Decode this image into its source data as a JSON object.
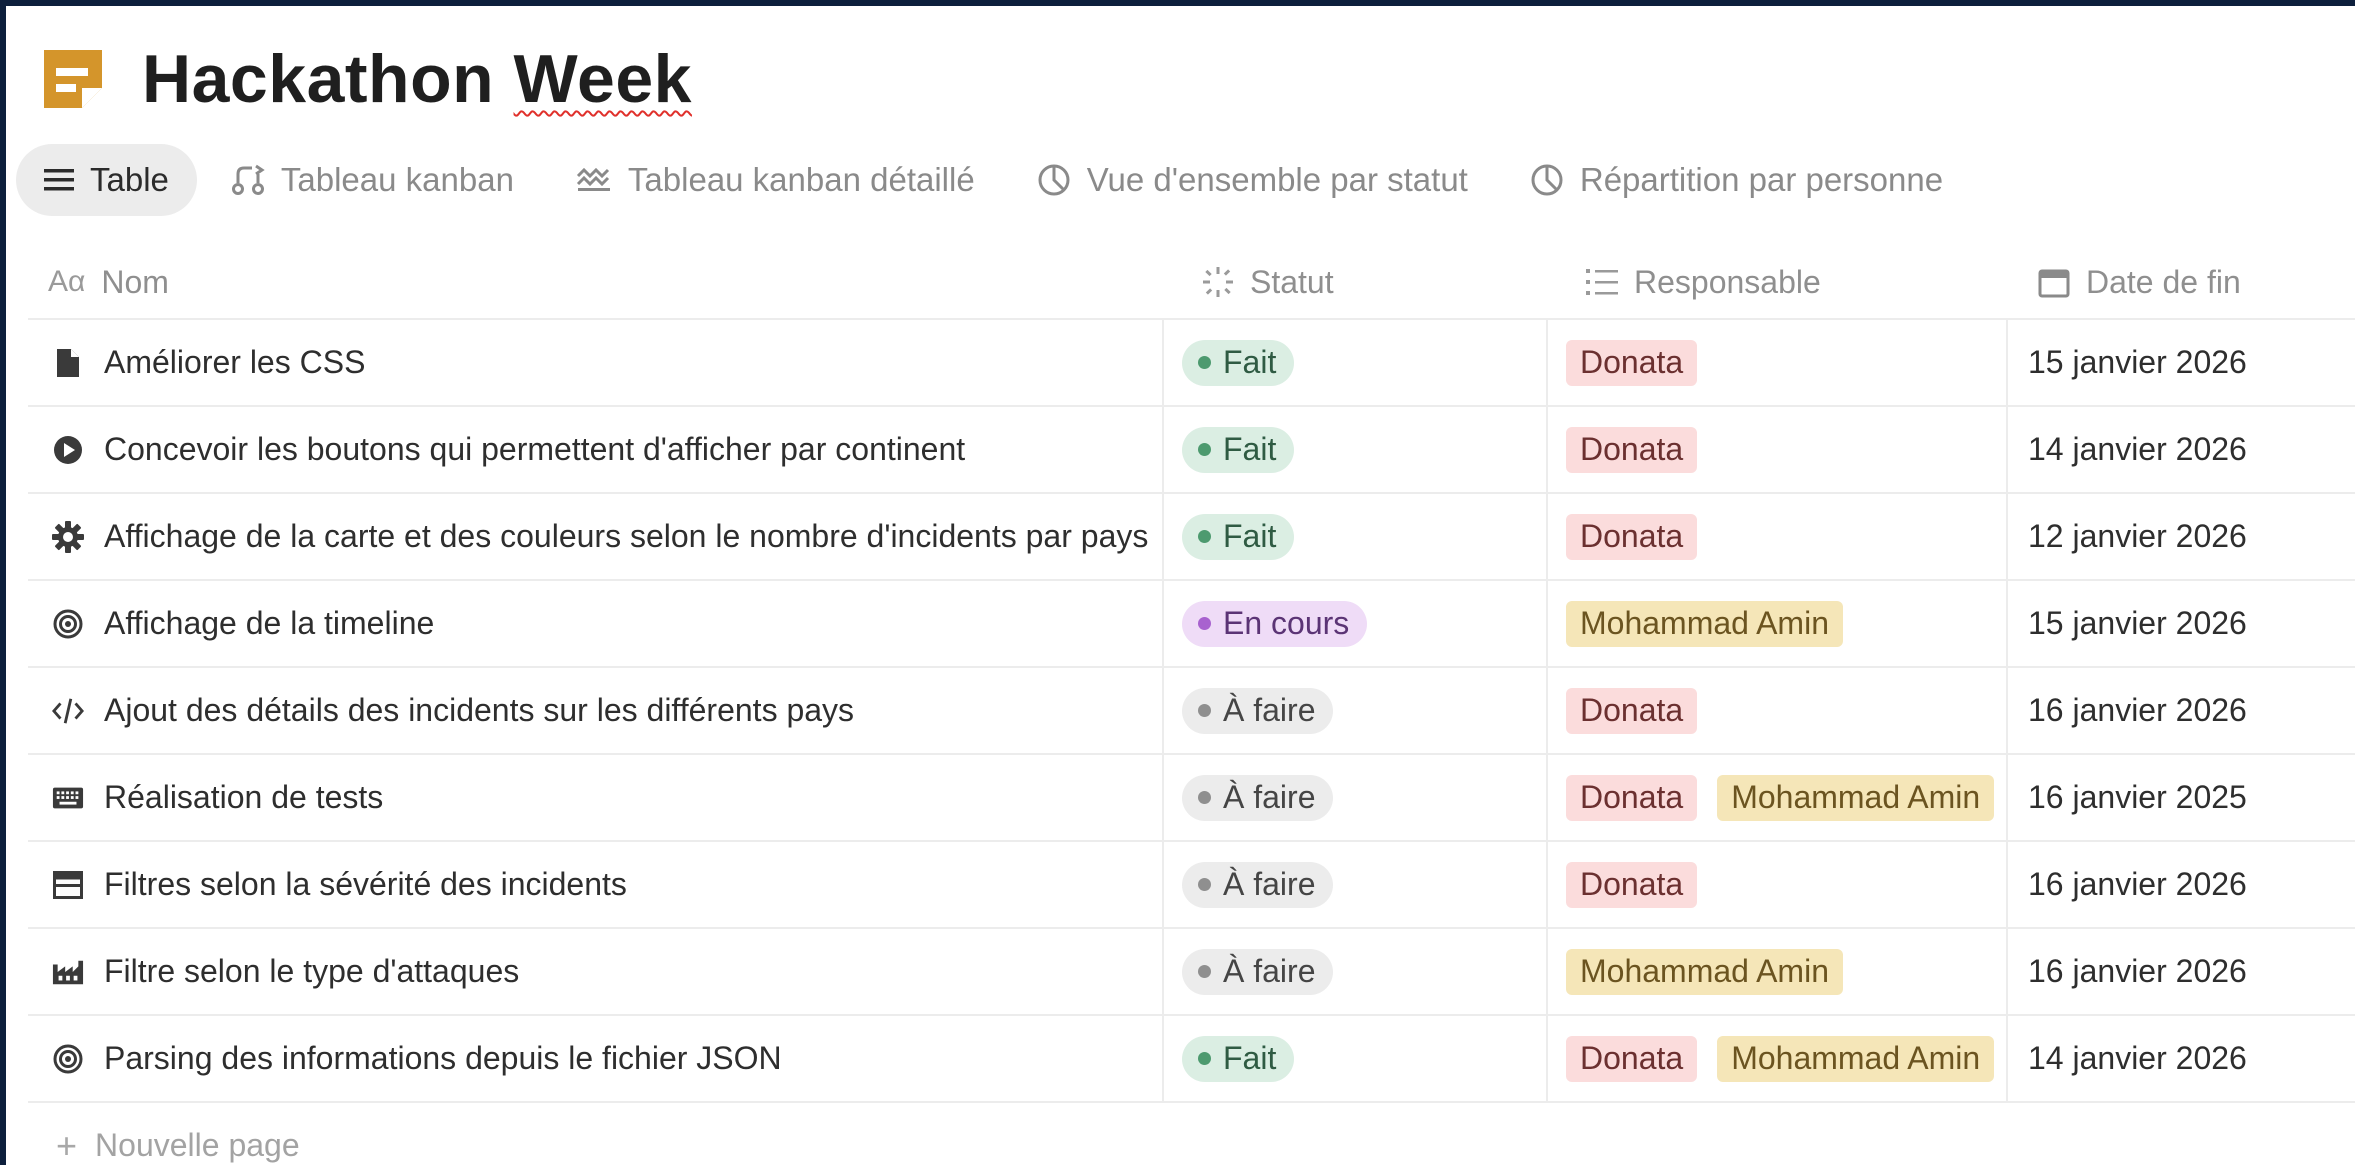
{
  "page": {
    "title_word1": "Hackathon",
    "title_word2": "Week",
    "icon": "page-doc-icon",
    "icon_color": "#d4952b"
  },
  "tabs": [
    {
      "label": "Table",
      "icon": "list-icon",
      "active": true
    },
    {
      "label": "Tableau kanban",
      "icon": "kanban-icon",
      "active": false
    },
    {
      "label": "Tableau kanban détaillé",
      "icon": "kanban-detail-icon",
      "active": false
    },
    {
      "label": "Vue d'ensemble par statut",
      "icon": "pie-chart-icon",
      "active": false
    },
    {
      "label": "Répartition par personne",
      "icon": "pie-chart-icon",
      "active": false
    }
  ],
  "columns": {
    "name": "Nom",
    "status": "Statut",
    "owner": "Responsable",
    "due": "Date de fin"
  },
  "status_colors": {
    "Fait": {
      "bg": "#dbeee3",
      "dot": "#4d9a6f",
      "text": "#2f5b43"
    },
    "En cours": {
      "bg": "#efdcf7",
      "dot": "#a862cf",
      "text": "#5b3475"
    },
    "À faire": {
      "bg": "#ececec",
      "dot": "#8f8f8f",
      "text": "#454545"
    }
  },
  "person_colors": {
    "Donata": {
      "bg": "#fbdcdc",
      "text": "#6b3030"
    },
    "Mohammad Amin": {
      "bg": "#f5e6b8",
      "text": "#6b5420"
    }
  },
  "rows": [
    {
      "icon": "file-icon",
      "name": "Améliorer les CSS",
      "status": "Fait",
      "owners": [
        "Donata"
      ],
      "due": "15 janvier 2026"
    },
    {
      "icon": "play-circle-icon",
      "name": "Concevoir les boutons qui permettent d'afficher par continent",
      "status": "Fait",
      "owners": [
        "Donata"
      ],
      "due": "14 janvier 2026"
    },
    {
      "icon": "gear-icon",
      "name": "Affichage de la carte et des couleurs selon le nombre d'incidents par pays",
      "status": "Fait",
      "owners": [
        "Donata"
      ],
      "due": "12 janvier 2026"
    },
    {
      "icon": "target-icon",
      "name": "Affichage de la timeline",
      "status": "En cours",
      "owners": [
        "Mohammad Amin"
      ],
      "due": "15 janvier 2026"
    },
    {
      "icon": "code-icon",
      "name": "Ajout des détails des incidents sur les différents pays",
      "status": "À faire",
      "owners": [
        "Donata"
      ],
      "due": "16 janvier 2026"
    },
    {
      "icon": "keyboard-icon",
      "name": "Réalisation de tests",
      "status": "À faire",
      "owners": [
        "Donata",
        "Mohammad Amin"
      ],
      "due": "16 janvier 2025"
    },
    {
      "icon": "window-icon",
      "name": "Filtres selon la sévérité des incidents",
      "status": "À faire",
      "owners": [
        "Donata"
      ],
      "due": "16 janvier 2026"
    },
    {
      "icon": "factory-icon",
      "name": "Filtre selon le type d'attaques",
      "status": "À faire",
      "owners": [
        "Mohammad Amin"
      ],
      "due": "16 janvier 2026"
    },
    {
      "icon": "target-icon",
      "name": "Parsing des informations depuis le fichier JSON",
      "status": "Fait",
      "owners": [
        "Donata",
        "Mohammad Amin"
      ],
      "due": "14 janvier 2026"
    }
  ],
  "new_page_label": "Nouvelle page"
}
